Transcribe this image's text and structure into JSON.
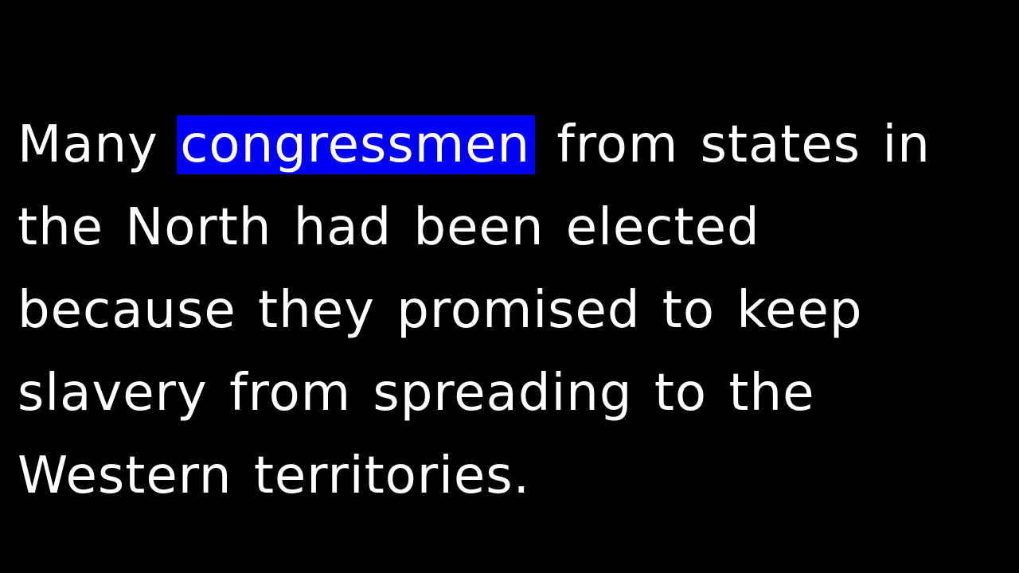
{
  "caption": {
    "line1": {
      "before": "Many",
      "highlighted": "congressmen",
      "after": "from states in"
    },
    "line2": "the North had been elected",
    "line3": "because they promised to keep",
    "line4": "slavery from spreading to the",
    "line5": "Western territories."
  },
  "colors": {
    "background": "#000000",
    "text": "#ffffff",
    "highlight": "#0000f5"
  }
}
